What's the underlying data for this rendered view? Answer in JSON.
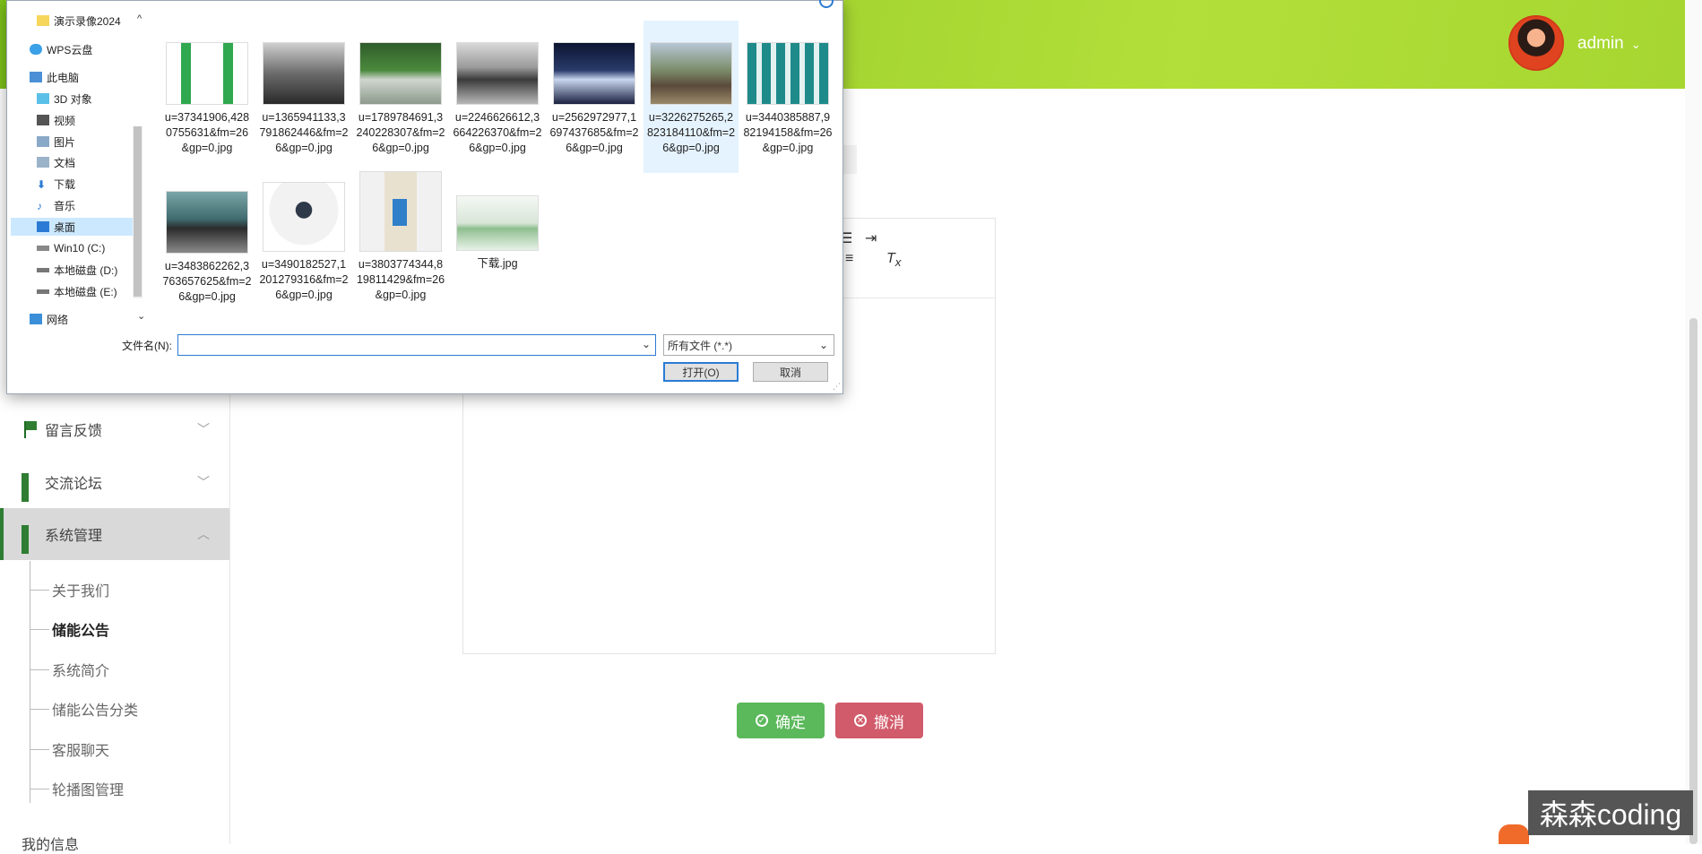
{
  "header": {
    "username": "admin",
    "caret": "⌄"
  },
  "sidebar": {
    "items": [
      {
        "label": "留言反馈",
        "icon": "flag-icon"
      },
      {
        "label": "交流论坛",
        "icon": "grid-icon"
      },
      {
        "label": "系统管理",
        "icon": "grid-icon"
      }
    ],
    "submenu": [
      {
        "label": "关于我们"
      },
      {
        "label": "储能公告"
      },
      {
        "label": "系统简介"
      },
      {
        "label": "储能公告分类"
      },
      {
        "label": "客服聊天"
      },
      {
        "label": "轮播图管理"
      }
    ],
    "bottom_label": "我的信息"
  },
  "actions": {
    "confirm": "确定",
    "cancel": "撤消"
  },
  "watermark": "森森coding",
  "dialog": {
    "tree": [
      {
        "label": "演示录像2024",
        "icon": "folder-icon"
      },
      {
        "label": "WPS云盘",
        "icon": "cloud-icon"
      },
      {
        "label": "此电脑",
        "icon": "computer-icon"
      },
      {
        "label": "3D 对象",
        "icon": "cube-icon"
      },
      {
        "label": "视频",
        "icon": "video-icon"
      },
      {
        "label": "图片",
        "icon": "picture-icon"
      },
      {
        "label": "文档",
        "icon": "document-icon"
      },
      {
        "label": "下载",
        "icon": "download-icon"
      },
      {
        "label": "音乐",
        "icon": "music-icon"
      },
      {
        "label": "桌面",
        "icon": "desktop-icon"
      },
      {
        "label": "Win10 (C:)",
        "icon": "drive-icon"
      },
      {
        "label": "本地磁盘 (D:)",
        "icon": "drive-icon"
      },
      {
        "label": "本地磁盘 (E:)",
        "icon": "drive-icon"
      },
      {
        "label": "网络",
        "icon": "network-icon"
      }
    ],
    "files": [
      {
        "name": "u=37341906,4280755631&fm=26&gp=0.jpg"
      },
      {
        "name": "u=1365941133,3791862446&fm=26&gp=0.jpg"
      },
      {
        "name": "u=1789784691,3240228307&fm=26&gp=0.jpg"
      },
      {
        "name": "u=2246626612,3664226370&fm=26&gp=0.jpg"
      },
      {
        "name": "u=2562972977,1697437685&fm=26&gp=0.jpg"
      },
      {
        "name": "u=3226275265,2823184110&fm=26&gp=0.jpg"
      },
      {
        "name": "u=3440385887,982194158&fm=26&gp=0.jpg"
      },
      {
        "name": "u=3483862262,3763657625&fm=26&gp=0.jpg"
      },
      {
        "name": "u=3490182527,1201279316&fm=26&gp=0.jpg"
      },
      {
        "name": "u=3803774344,819811429&fm=26&gp=0.jpg"
      },
      {
        "name": "下载.jpg"
      }
    ],
    "filename_label": "文件名(N):",
    "filename_value": "",
    "filetype": "所有文件 (*.*)",
    "open_button": "打开(O)",
    "cancel_button": "取消"
  },
  "colors": {
    "header_green": "#9ed12d",
    "sidebar_accent": "#2e7d32",
    "confirm_green": "#5bb85b",
    "cancel_red": "#d15b6a"
  }
}
